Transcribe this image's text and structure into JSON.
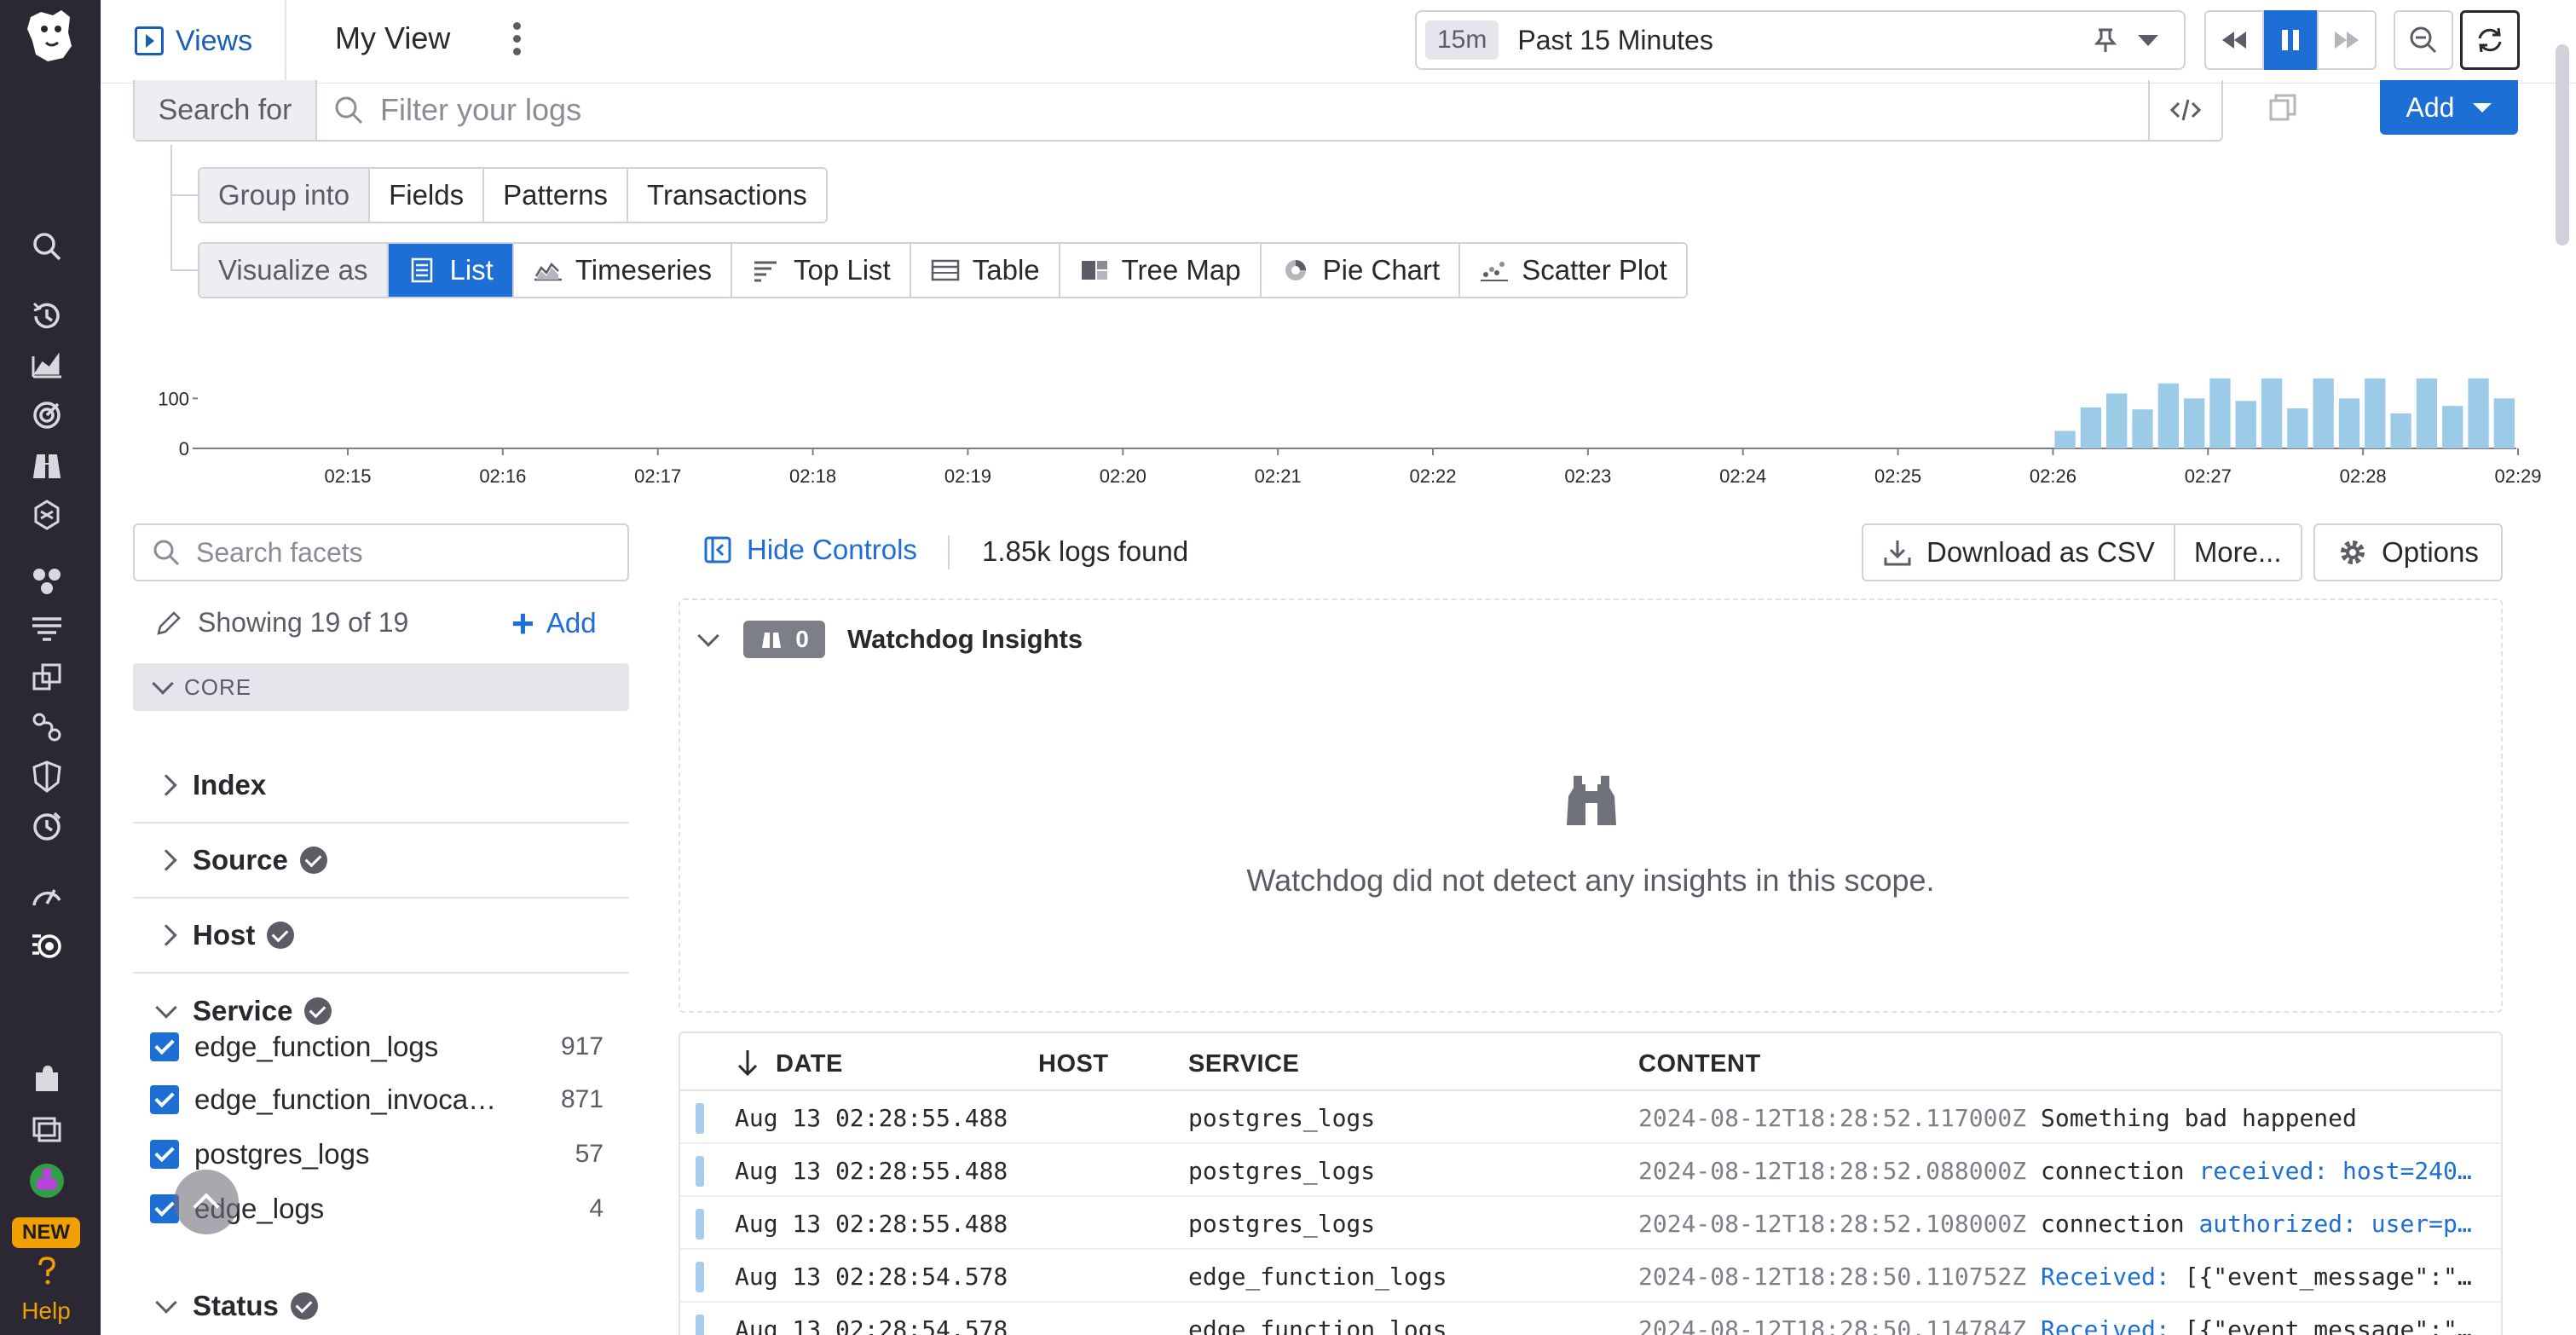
{
  "topbar": {
    "views_label": "Views",
    "view_name": "My View",
    "time_badge": "15m",
    "time_label": "Past 15 Minutes"
  },
  "search": {
    "label": "Search for",
    "placeholder": "Filter your logs",
    "add_label": "Add"
  },
  "group_into": {
    "label": "Group into",
    "options": [
      "Fields",
      "Patterns",
      "Transactions"
    ]
  },
  "visualize_as": {
    "label": "Visualize as",
    "selected": "List",
    "options": [
      "List",
      "Timeseries",
      "Top List",
      "Table",
      "Tree Map",
      "Pie Chart",
      "Scatter Plot"
    ]
  },
  "chart_data": {
    "type": "bar",
    "y_ticks": [
      "100",
      "0"
    ],
    "ylim": [
      0,
      150
    ],
    "x_ticks": [
      "02:15",
      "02:16",
      "02:17",
      "02:18",
      "02:19",
      "02:20",
      "02:21",
      "02:22",
      "02:23",
      "02:24",
      "02:25",
      "02:26",
      "02:27",
      "02:28",
      "02:29"
    ],
    "bar_color": "#9ccbe8",
    "series": [
      {
        "values": [
          35,
          82,
          110,
          78,
          130,
          100,
          140,
          95,
          140,
          80,
          140,
          100,
          140,
          70,
          140,
          85,
          140,
          100
        ]
      }
    ]
  },
  "facets": {
    "search_placeholder": "Search facets",
    "showing": "Showing 19 of 19",
    "add_label": "Add",
    "group_label": "CORE",
    "items": [
      {
        "label": "Index"
      },
      {
        "label": "Source"
      },
      {
        "label": "Host"
      },
      {
        "label": "Service"
      }
    ],
    "services": [
      {
        "name": "edge_function_logs",
        "count": "917"
      },
      {
        "name": "edge_function_invocation_logs",
        "count": "871"
      },
      {
        "name": "postgres_logs",
        "count": "57"
      },
      {
        "name": "edge_logs",
        "count": "4"
      }
    ],
    "status_label": "Status"
  },
  "results": {
    "hide_controls": "Hide Controls",
    "count": "1.85k logs found",
    "download": "Download as CSV",
    "more": "More...",
    "options": "Options"
  },
  "watchdog": {
    "count": "0",
    "title": "Watchdog Insights",
    "empty": "Watchdog did not detect any insights in this scope."
  },
  "table": {
    "headers": {
      "date": "DATE",
      "host": "HOST",
      "service": "SERVICE",
      "content": "CONTENT"
    },
    "rows": [
      {
        "date": "Aug 13 02:28:55.488",
        "service": "postgres_logs",
        "ts": "2024-08-12T18:28:52.117000Z",
        "msg": "Something bad happened",
        "rest": ""
      },
      {
        "date": "Aug 13 02:28:55.488",
        "service": "postgres_logs",
        "ts": "2024-08-12T18:28:52.088000Z",
        "msg": "connection",
        "rest": "received: host=240…"
      },
      {
        "date": "Aug 13 02:28:55.488",
        "service": "postgres_logs",
        "ts": "2024-08-12T18:28:52.108000Z",
        "msg": "connection",
        "rest": "authorized: user=p…"
      },
      {
        "date": "Aug 13 02:28:54.578",
        "service": "edge_function_logs",
        "ts": "2024-08-12T18:28:50.110752Z",
        "msg": "Received:",
        "rest": "[{\"event_message\":\"…"
      },
      {
        "date": "Aug 13 02:28:54.578",
        "service": "edge_function_logs",
        "ts": "2024-08-12T18:28:50.114784Z",
        "msg": "Received:",
        "rest": "[{\"event_message\":\"…"
      }
    ]
  },
  "sidebar": {
    "new_badge": "NEW",
    "help": "Help"
  },
  "colors": {
    "accent": "#1d6fd6",
    "sidebar_bg": "#2b2833",
    "bar": "#9ccbe8",
    "new_badge": "#f0a000"
  }
}
